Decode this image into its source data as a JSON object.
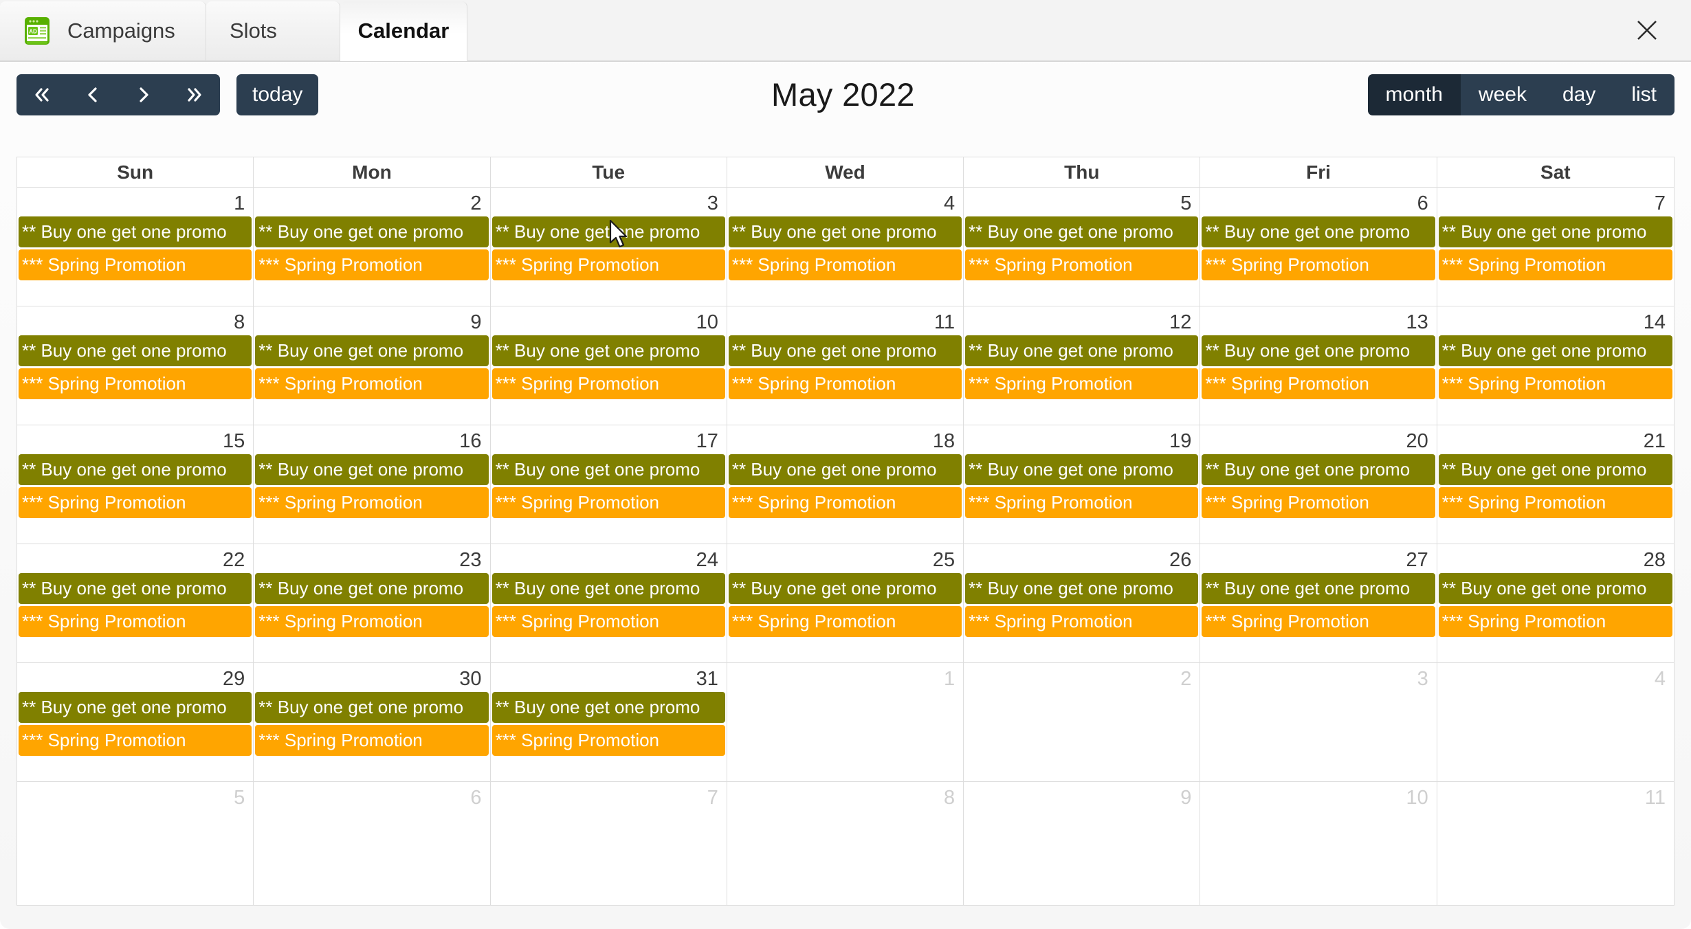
{
  "window": {
    "close_label": "✕"
  },
  "tabs": [
    {
      "id": "campaigns",
      "label": "Campaigns",
      "icon": "ad-icon",
      "active": false
    },
    {
      "id": "slots",
      "label": "Slots",
      "icon": null,
      "active": false
    },
    {
      "id": "calendar",
      "label": "Calendar",
      "icon": null,
      "active": true
    }
  ],
  "toolbar": {
    "nav": [
      {
        "name": "prev-year-button",
        "label": "«",
        "icon": "double-chevron-left-icon"
      },
      {
        "name": "prev-month-button",
        "label": "‹",
        "icon": "chevron-left-icon"
      },
      {
        "name": "next-month-button",
        "label": "›",
        "icon": "chevron-right-icon"
      },
      {
        "name": "next-year-button",
        "label": "»",
        "icon": "double-chevron-right-icon"
      }
    ],
    "today_label": "today",
    "title": "May 2022",
    "views": [
      {
        "id": "month",
        "label": "month",
        "active": true
      },
      {
        "id": "week",
        "label": "week",
        "active": false
      },
      {
        "id": "day",
        "label": "day",
        "active": false
      },
      {
        "id": "list",
        "label": "list",
        "active": false
      }
    ]
  },
  "colors": {
    "toolbar_button": "#2c3e50",
    "toolbar_button_active": "#1c2936",
    "event_promo": "#808000",
    "event_spring": "#ffa500",
    "grid_border": "#dddddd",
    "other_month_text": "#cfcfcf"
  },
  "calendar": {
    "weekdays": [
      "Sun",
      "Mon",
      "Tue",
      "Wed",
      "Thu",
      "Fri",
      "Sat"
    ],
    "event_types": {
      "promo": {
        "title": "** Buy one get one promo",
        "color": "#808000"
      },
      "spring": {
        "title": "*** Spring Promotion",
        "color": "#ffa500"
      }
    },
    "weeks": [
      {
        "layout": "has-events",
        "days": [
          {
            "number": "1",
            "other_month": false,
            "events": [
              "promo",
              "spring"
            ]
          },
          {
            "number": "2",
            "other_month": false,
            "events": [
              "promo",
              "spring"
            ]
          },
          {
            "number": "3",
            "other_month": false,
            "events": [
              "promo",
              "spring"
            ]
          },
          {
            "number": "4",
            "other_month": false,
            "events": [
              "promo",
              "spring"
            ]
          },
          {
            "number": "5",
            "other_month": false,
            "events": [
              "promo",
              "spring"
            ]
          },
          {
            "number": "6",
            "other_month": false,
            "events": [
              "promo",
              "spring"
            ]
          },
          {
            "number": "7",
            "other_month": false,
            "events": [
              "promo",
              "spring"
            ]
          }
        ]
      },
      {
        "layout": "has-events",
        "days": [
          {
            "number": "8",
            "other_month": false,
            "events": [
              "promo",
              "spring"
            ]
          },
          {
            "number": "9",
            "other_month": false,
            "events": [
              "promo",
              "spring"
            ]
          },
          {
            "number": "10",
            "other_month": false,
            "events": [
              "promo",
              "spring"
            ]
          },
          {
            "number": "11",
            "other_month": false,
            "events": [
              "promo",
              "spring"
            ]
          },
          {
            "number": "12",
            "other_month": false,
            "events": [
              "promo",
              "spring"
            ]
          },
          {
            "number": "13",
            "other_month": false,
            "events": [
              "promo",
              "spring"
            ]
          },
          {
            "number": "14",
            "other_month": false,
            "events": [
              "promo",
              "spring"
            ]
          }
        ]
      },
      {
        "layout": "has-events",
        "days": [
          {
            "number": "15",
            "other_month": false,
            "events": [
              "promo",
              "spring"
            ]
          },
          {
            "number": "16",
            "other_month": false,
            "events": [
              "promo",
              "spring"
            ]
          },
          {
            "number": "17",
            "other_month": false,
            "events": [
              "promo",
              "spring"
            ]
          },
          {
            "number": "18",
            "other_month": false,
            "events": [
              "promo",
              "spring"
            ]
          },
          {
            "number": "19",
            "other_month": false,
            "events": [
              "promo",
              "spring"
            ]
          },
          {
            "number": "20",
            "other_month": false,
            "events": [
              "promo",
              "spring"
            ]
          },
          {
            "number": "21",
            "other_month": false,
            "events": [
              "promo",
              "spring"
            ]
          }
        ]
      },
      {
        "layout": "has-events",
        "days": [
          {
            "number": "22",
            "other_month": false,
            "events": [
              "promo",
              "spring"
            ]
          },
          {
            "number": "23",
            "other_month": false,
            "events": [
              "promo",
              "spring"
            ]
          },
          {
            "number": "24",
            "other_month": false,
            "events": [
              "promo",
              "spring"
            ]
          },
          {
            "number": "25",
            "other_month": false,
            "events": [
              "promo",
              "spring"
            ]
          },
          {
            "number": "26",
            "other_month": false,
            "events": [
              "promo",
              "spring"
            ]
          },
          {
            "number": "27",
            "other_month": false,
            "events": [
              "promo",
              "spring"
            ]
          },
          {
            "number": "28",
            "other_month": false,
            "events": [
              "promo",
              "spring"
            ]
          }
        ]
      },
      {
        "layout": "has-events",
        "days": [
          {
            "number": "29",
            "other_month": false,
            "events": [
              "promo",
              "spring"
            ]
          },
          {
            "number": "30",
            "other_month": false,
            "events": [
              "promo",
              "spring"
            ]
          },
          {
            "number": "31",
            "other_month": false,
            "events": [
              "promo",
              "spring"
            ]
          },
          {
            "number": "1",
            "other_month": true,
            "events": []
          },
          {
            "number": "2",
            "other_month": true,
            "events": []
          },
          {
            "number": "3",
            "other_month": true,
            "events": []
          },
          {
            "number": "4",
            "other_month": true,
            "events": []
          }
        ]
      },
      {
        "layout": "empty-row",
        "days": [
          {
            "number": "5",
            "other_month": true,
            "events": []
          },
          {
            "number": "6",
            "other_month": true,
            "events": []
          },
          {
            "number": "7",
            "other_month": true,
            "events": []
          },
          {
            "number": "8",
            "other_month": true,
            "events": []
          },
          {
            "number": "9",
            "other_month": true,
            "events": []
          },
          {
            "number": "10",
            "other_month": true,
            "events": []
          },
          {
            "number": "11",
            "other_month": true,
            "events": []
          }
        ]
      }
    ]
  }
}
